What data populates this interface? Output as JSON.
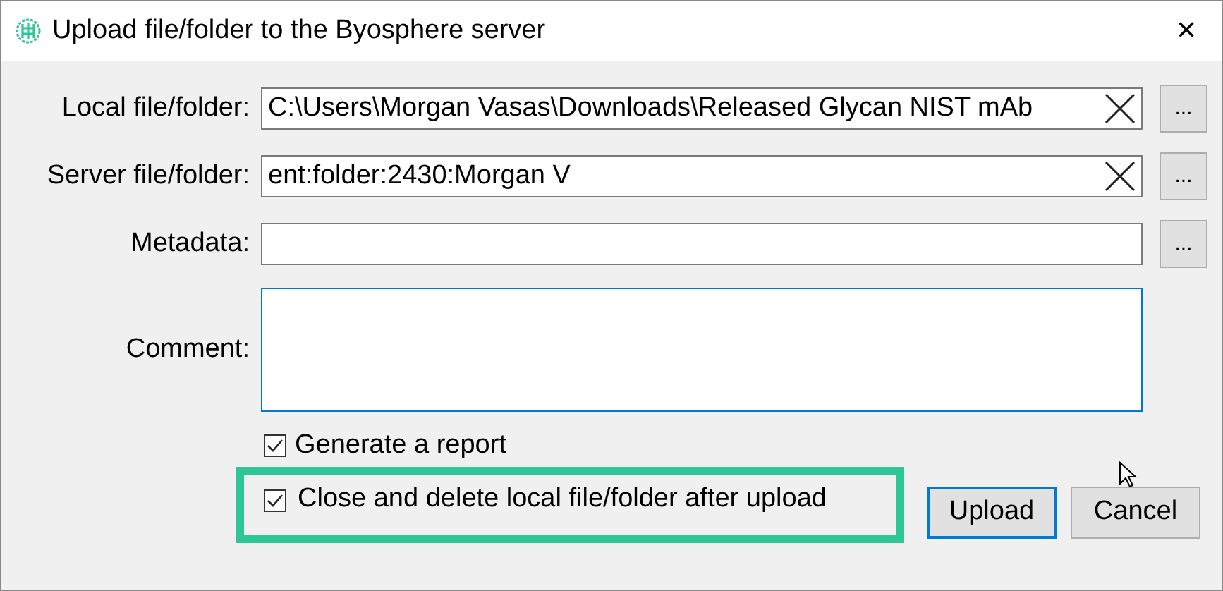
{
  "window": {
    "title": "Upload file/folder to the Byosphere server",
    "close": "×"
  },
  "fields": [
    {
      "kind": "path",
      "label": "Local file/folder:",
      "value": "C:\\Users\\Morgan Vasas\\Downloads\\Released Glycan NIST mAb",
      "clear": true,
      "browse": "..."
    },
    {
      "kind": "path",
      "label": "Server file/folder:",
      "value": "ent:folder:2430:Morgan V",
      "clear": true,
      "browse": "..."
    },
    {
      "kind": "path",
      "label": "Metadata:",
      "clear": false,
      "browse": "..."
    },
    {
      "kind": "area",
      "label": "Comment:",
      "focused": true
    }
  ],
  "options": [
    {
      "label": "Generate a report",
      "checked": true,
      "highlighted": false
    },
    {
      "label": "Close and delete local file/folder after upload",
      "checked": true,
      "highlighted": true
    }
  ],
  "buttons": [
    {
      "label": "Upload",
      "default": true
    },
    {
      "label": "Cancel",
      "default": false
    }
  ]
}
